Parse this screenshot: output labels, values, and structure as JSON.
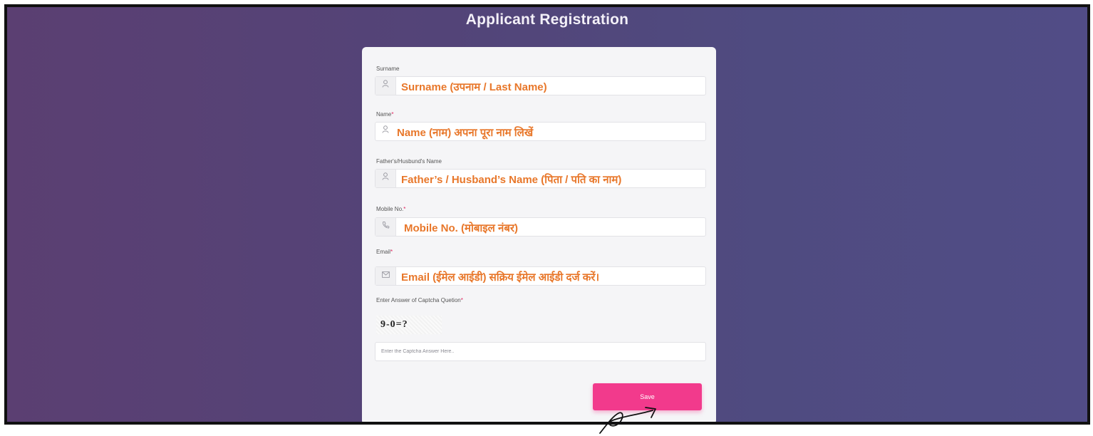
{
  "page": {
    "title": "Applicant Registration"
  },
  "form": {
    "surname": {
      "label": "Surname",
      "required": "",
      "value": "Surname (उपनाम / Last Name)"
    },
    "name": {
      "label": "Name",
      "required": "*",
      "value": "Name (नाम) अपना पूरा नाम लिखें"
    },
    "father_husband": {
      "label": "Father's/Husbund's Name",
      "required": "",
      "value": "Father’s / Husband’s Name (पिता / पति का नाम)"
    },
    "mobile": {
      "label": "Mobile No.",
      "required": "*",
      "value": "Mobile No. (मोबाइल नंबर)"
    },
    "email": {
      "label": "Email",
      "required": "*",
      "value": "Email (ईमेल आईडी) सक्रिय ईमेल आईडी दर्ज करें।"
    },
    "captcha": {
      "label": "Enter Answer of Captcha Quetion",
      "required": "*",
      "question": "9-0=?",
      "placeholder": "Enter the Captcha Answer Here.."
    },
    "save_label": "Save"
  },
  "icons": {
    "surname": "user-icon",
    "name": "user-icon",
    "father_husband": "user-icon",
    "mobile": "phone-icon",
    "email": "envelope-icon"
  },
  "colors": {
    "accent": "#f23a8c",
    "annotation": "#e8772a",
    "background_from": "#5b3f72",
    "background_to": "#514c86"
  }
}
